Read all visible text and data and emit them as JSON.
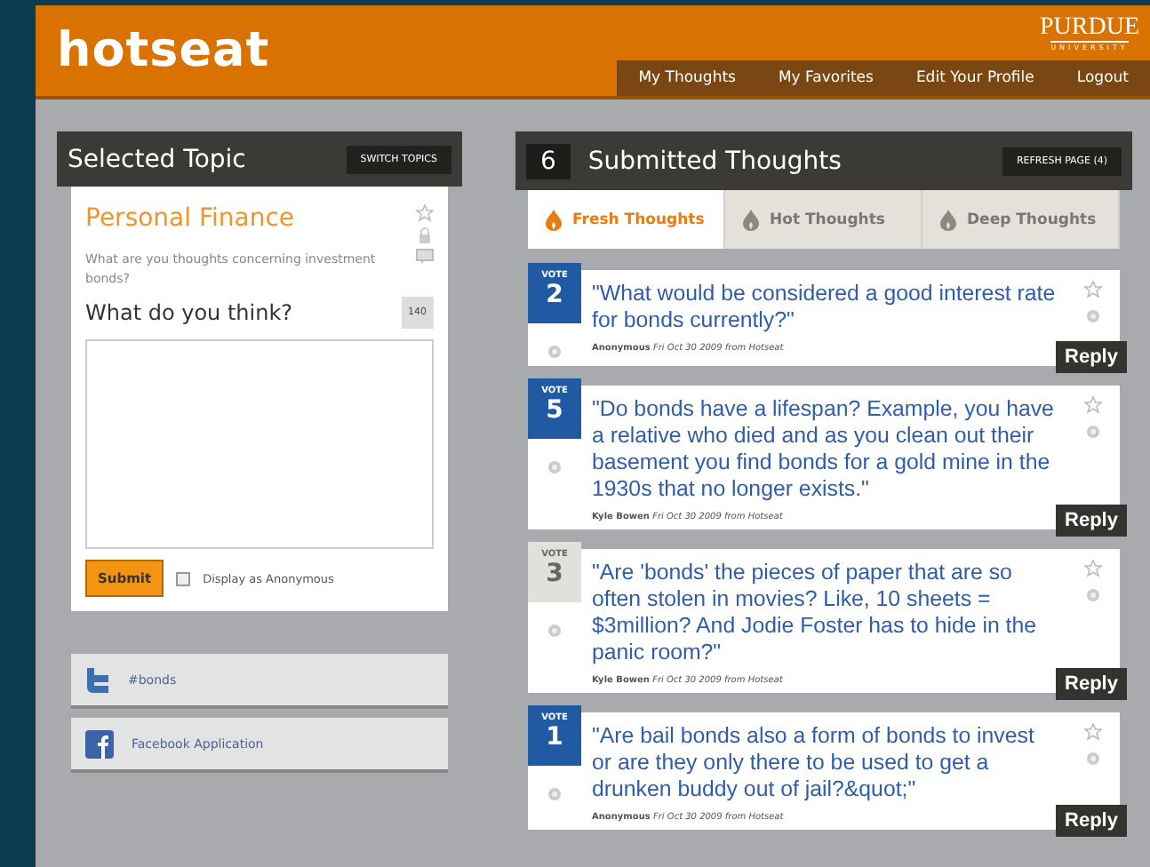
{
  "header": {
    "logo": "hotseat",
    "university": "PURDUE",
    "university_sub": "UNIVERSITY",
    "nav": [
      "My Thoughts",
      "My Favorites",
      "Edit Your Profile",
      "Logout"
    ]
  },
  "topic_panel": {
    "title": "Selected Topic",
    "switch_button": "SWITCH TOPICS",
    "topic": "Personal Finance",
    "question": "What are you thoughts concerning investment bonds?",
    "prompt": "What do you think?",
    "char_count": "140",
    "submit": "Submit",
    "anonymous": {
      "label": "Display as Anonymous",
      "checked": false
    }
  },
  "links": [
    {
      "kind": "twitter",
      "label": "#bonds"
    },
    {
      "kind": "facebook",
      "label": "Facebook Application"
    }
  ],
  "thoughts_panel": {
    "count": "6",
    "title": "Submitted Thoughts",
    "refresh_button": "REFRESH PAGE (4)",
    "tabs": [
      {
        "label": "Fresh Thoughts",
        "selected": true
      },
      {
        "label": "Hot Thoughts",
        "selected": false
      },
      {
        "label": "Deep Thoughts",
        "selected": false
      }
    ],
    "posts": [
      {
        "vote_label": "VOTE",
        "votes": "2",
        "voted": true,
        "text": "\"What would be considered a good interest rate for bonds currently?\"",
        "author": "Anonymous",
        "meta": "Fri Oct 30 2009 from Hotseat",
        "reply": "Reply"
      },
      {
        "vote_label": "VOTE",
        "votes": "5",
        "voted": true,
        "text": "\"Do bonds have a lifespan? Example, you have a relative who died and as you clean out their basement you find bonds for a gold mine in the 1930s that no longer exists.\"",
        "author": "Kyle Bowen",
        "meta": "Fri Oct 30 2009 from Hotseat",
        "reply": "Reply"
      },
      {
        "vote_label": "VOTE",
        "votes": "3",
        "voted": false,
        "text": "\"Are 'bonds' the pieces of paper that are so often stolen in movies? Like, 10 sheets = $3million? And Jodie Foster has to hide in the panic room?\"",
        "author": "Kyle Bowen",
        "meta": "Fri Oct 30 2009 from Hotseat",
        "reply": "Reply"
      },
      {
        "vote_label": "VOTE",
        "votes": "1",
        "voted": true,
        "text": "\"Are bail bonds also a form of bonds to invest or are they only there to be used to get a drunken buddy out of jail?&quot;\"",
        "author": "Anonymous",
        "meta": "Fri Oct 30 2009 from Hotseat",
        "reply": "Reply"
      }
    ]
  }
}
